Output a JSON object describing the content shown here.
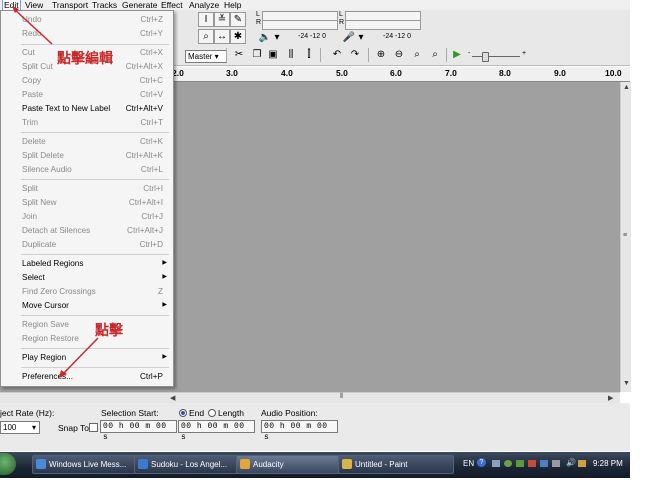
{
  "menubar": {
    "items": [
      "Edit",
      "View",
      "Transport",
      "Tracks",
      "Generate",
      "Effect",
      "Analyze",
      "Help"
    ]
  },
  "edit_menu": {
    "items": [
      {
        "label": "Undo",
        "shortcut": "Ctrl+Z",
        "enabled": false
      },
      {
        "label": "Redo",
        "shortcut": "Ctrl+Y",
        "enabled": false
      },
      {
        "label": "Cut",
        "shortcut": "Ctrl+X",
        "enabled": false
      },
      {
        "label": "Split Cut",
        "shortcut": "Ctrl+Alt+X",
        "enabled": false
      },
      {
        "label": "Copy",
        "shortcut": "Ctrl+C",
        "enabled": false
      },
      {
        "label": "Paste",
        "shortcut": "Ctrl+V",
        "enabled": false
      },
      {
        "label": "Paste Text to New Label",
        "shortcut": "Ctrl+Alt+V",
        "enabled": true
      },
      {
        "label": "Trim",
        "shortcut": "Ctrl+T",
        "enabled": false
      },
      {
        "label": "Delete",
        "shortcut": "Ctrl+K",
        "enabled": false
      },
      {
        "label": "Split Delete",
        "shortcut": "Ctrl+Alt+K",
        "enabled": false
      },
      {
        "label": "Silence Audio",
        "shortcut": "Ctrl+L",
        "enabled": false
      },
      {
        "label": "Split",
        "shortcut": "Ctrl+I",
        "enabled": false
      },
      {
        "label": "Split New",
        "shortcut": "Ctrl+Alt+I",
        "enabled": false
      },
      {
        "label": "Join",
        "shortcut": "Ctrl+J",
        "enabled": false
      },
      {
        "label": "Detach at Silences",
        "shortcut": "Ctrl+Alt+J",
        "enabled": false
      },
      {
        "label": "Duplicate",
        "shortcut": "Ctrl+D",
        "enabled": false
      },
      {
        "label": "Labeled Regions",
        "shortcut": "",
        "enabled": true,
        "submenu": true
      },
      {
        "label": "Select",
        "shortcut": "",
        "enabled": true,
        "submenu": true
      },
      {
        "label": "Find Zero Crossings",
        "shortcut": "Z",
        "enabled": false
      },
      {
        "label": "Move Cursor",
        "shortcut": "",
        "enabled": true,
        "submenu": true
      },
      {
        "label": "Region Save",
        "shortcut": "",
        "enabled": false
      },
      {
        "label": "Region Restore",
        "shortcut": "",
        "enabled": false
      },
      {
        "label": "Play Region",
        "shortcut": "",
        "enabled": true,
        "submenu": true
      },
      {
        "label": "Preferences...",
        "shortcut": "Ctrl+P",
        "enabled": true
      }
    ]
  },
  "annotations": {
    "click_edit": "點擊編輯",
    "click": "點擊"
  },
  "toolbar": {
    "meter_l": "L",
    "meter_r": "R",
    "meter_scale_1": "-24  -12  0",
    "meter_scale_2": "-24  -12  0",
    "meter_scale_3": "-24  -12  0",
    "meter_scale_4": "-24  -12  0",
    "device_select": "Master",
    "slider_minus": "-",
    "slider_plus": "+"
  },
  "ruler": {
    "ticks": [
      "2.0",
      "3.0",
      "4.0",
      "5.0",
      "6.0",
      "7.0",
      "8.0",
      "9.0",
      "10.0"
    ]
  },
  "selection_bar": {
    "project_rate_label": "ject Rate (Hz):",
    "project_rate_value": "100",
    "snap_to_label": "Snap To",
    "selection_start_label": "Selection Start:",
    "end_label": "End",
    "length_label": "Length",
    "audio_position_label": "Audio Position:",
    "selection_start_value": "00 h 00 m 00 s",
    "end_value": "00 h 00 m 00 s",
    "audio_position_value": "00 h 00 m 00 s"
  },
  "taskbar": {
    "buttons": [
      "Windows Live Mess...",
      "Sudoku - Los Angel...",
      "Audacity",
      "Untitled - Paint"
    ],
    "language": "EN",
    "clock": "9:28 PM"
  },
  "colors": {
    "annotation_red": "#c8282a",
    "track_bg": "#a0a0a0",
    "menu_bg": "#f5f5f5"
  }
}
